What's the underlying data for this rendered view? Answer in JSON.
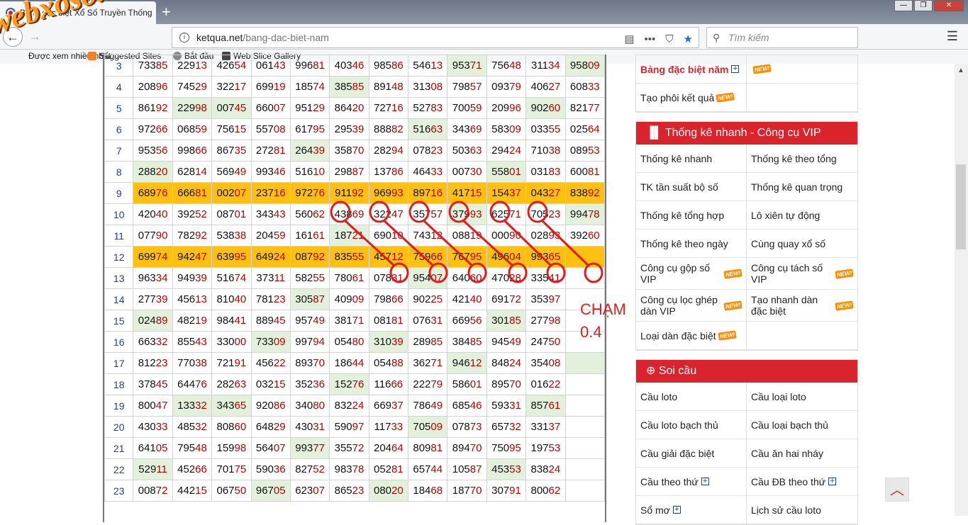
{
  "browser": {
    "tab_title": "Bảng đặc biệt Xổ Số Truyền Thống",
    "url_host": "ketqua.net",
    "url_path": "/bang-dac-biet-nam",
    "search_placeholder": "Tìm kiếm",
    "bookmarks": [
      "Được xem nhiều nhất",
      "Suggested Sites",
      "Bắt đầu",
      "Web Slice Gallery"
    ]
  },
  "watermark": "webxoso.net",
  "table": {
    "rows": [
      {
        "n": "3",
        "v": [
          "73385",
          "22913",
          "42654",
          "06143",
          "99681",
          "40346",
          "98586",
          "54613",
          "95371",
          "75648",
          "31134",
          "95809"
        ],
        "g": [
          8,
          11
        ]
      },
      {
        "n": "4",
        "v": [
          "20896",
          "74529",
          "32217",
          "69919",
          "18574",
          "38585",
          "89148",
          "31308",
          "79857",
          "09379",
          "40627",
          "60833"
        ],
        "g": [
          5
        ]
      },
      {
        "n": "5",
        "v": [
          "86192",
          "22998",
          "00745",
          "66007",
          "95129",
          "86420",
          "72716",
          "52783",
          "70059",
          "20996",
          "90260",
          "82177"
        ],
        "g": [
          1,
          2,
          10
        ]
      },
      {
        "n": "6",
        "v": [
          "97266",
          "06859",
          "75615",
          "55708",
          "61795",
          "29539",
          "88882",
          "51663",
          "34369",
          "58309",
          "03355",
          "02564"
        ],
        "g": [
          7
        ]
      },
      {
        "n": "7",
        "v": [
          "95356",
          "99866",
          "86735",
          "27281",
          "26439",
          "35870",
          "28294",
          "07823",
          "50363",
          "29424",
          "71038",
          "08953"
        ],
        "g": [
          4
        ]
      },
      {
        "n": "8",
        "v": [
          "28820",
          "62814",
          "56949",
          "99346",
          "51610",
          "29887",
          "13786",
          "46433",
          "00730",
          "55801",
          "03183",
          "60081"
        ],
        "g": [
          0,
          9
        ]
      },
      {
        "n": "9",
        "v": [
          "68976",
          "66681",
          "00207",
          "23716",
          "97276",
          "91192",
          "96993",
          "89716",
          "41715",
          "15437",
          "04327",
          "83892"
        ],
        "g": [
          3
        ],
        "hl": true
      },
      {
        "n": "10",
        "v": [
          "42040",
          "39252",
          "08701",
          "34343",
          "56062",
          "43869",
          "32247",
          "35757",
          "37993",
          "62571",
          "70523",
          "99478"
        ],
        "g": [
          8,
          11
        ]
      },
      {
        "n": "11",
        "v": [
          "07790",
          "78292",
          "53838",
          "20459",
          "16161",
          "18721",
          "69010",
          "74312",
          "08819",
          "00090",
          "02893",
          "39260"
        ],
        "g": [
          5
        ]
      },
      {
        "n": "12",
        "v": [
          "69974",
          "94247",
          "63995",
          "64924",
          "08792",
          "83555",
          "45712",
          "75966",
          "76795",
          "49604",
          "99365",
          ""
        ],
        "g": [
          1,
          2
        ],
        "hl": true
      },
      {
        "n": "13",
        "v": [
          "96334",
          "94939",
          "51674",
          "37311",
          "58255",
          "78061",
          "07831",
          "95407",
          "64060",
          "47028",
          "33541",
          ""
        ],
        "g": [
          7
        ]
      },
      {
        "n": "14",
        "v": [
          "27739",
          "45613",
          "81040",
          "78123",
          "30587",
          "40909",
          "79866",
          "90225",
          "42140",
          "69172",
          "35397",
          ""
        ],
        "g": [
          4
        ]
      },
      {
        "n": "15",
        "v": [
          "02489",
          "48219",
          "98441",
          "88945",
          "95749",
          "38171",
          "08181",
          "07631",
          "66956",
          "30185",
          "27798",
          ""
        ],
        "g": [
          0,
          9
        ]
      },
      {
        "n": "16",
        "v": [
          "66332",
          "85543",
          "33000",
          "73309",
          "99794",
          "05480",
          "31039",
          "28985",
          "38485",
          "94549",
          "24750",
          ""
        ],
        "g": [
          3,
          6
        ]
      },
      {
        "n": "17",
        "v": [
          "81223",
          "77038",
          "72191",
          "45622",
          "89370",
          "18644",
          "05488",
          "36271",
          "94612",
          "84824",
          "35408",
          ""
        ],
        "g": [
          8,
          11
        ]
      },
      {
        "n": "18",
        "v": [
          "37845",
          "64476",
          "28263",
          "03215",
          "35236",
          "15276",
          "11666",
          "22279",
          "58601",
          "89570",
          "01622",
          ""
        ],
        "g": [
          5
        ]
      },
      {
        "n": "19",
        "v": [
          "80047",
          "13332",
          "34365",
          "92086",
          "34080",
          "83224",
          "66937",
          "78649",
          "68546",
          "59331",
          "85761",
          ""
        ],
        "g": [
          1,
          2,
          10
        ]
      },
      {
        "n": "20",
        "v": [
          "43033",
          "48532",
          "80860",
          "64829",
          "43031",
          "59097",
          "11733",
          "70509",
          "07873",
          "65732",
          "33137",
          ""
        ],
        "g": [
          7
        ]
      },
      {
        "n": "21",
        "v": [
          "64105",
          "79548",
          "15998",
          "56407",
          "99377",
          "35572",
          "20464",
          "80981",
          "89470",
          "75095",
          "19753",
          ""
        ],
        "g": [
          4
        ]
      },
      {
        "n": "22",
        "v": [
          "52911",
          "45266",
          "70175",
          "59036",
          "82752",
          "98378",
          "05281",
          "65744",
          "10587",
          "45353",
          "83824",
          ""
        ],
        "g": [
          0,
          9
        ]
      },
      {
        "n": "23",
        "v": [
          "00872",
          "44215",
          "06750",
          "96705",
          "62307",
          "86523",
          "08020",
          "18468",
          "18770",
          "30791",
          "80062",
          ""
        ],
        "g": [
          3,
          6
        ]
      }
    ]
  },
  "annotation": {
    "line1": "CHẠM",
    "line2": "0.4"
  },
  "sidebar": {
    "top": {
      "item1": "Bảng đặc biệt năm",
      "item2": "Tạo phôi kết quả"
    },
    "new_label": "NEW!",
    "quick_stats": {
      "title": "Thống kê nhanh - Công cụ VIP",
      "items": [
        "Thống kê nhanh",
        "Thống kê theo tổng",
        "TK tần suất bộ số",
        "Thống kê quan trọng",
        "Thống kê tổng hợp",
        "Lô xiên tự động",
        "Thống kê theo ngày",
        "Cùng quay xổ số",
        "Công cụ gộp số VIP",
        "Công cụ tách số VIP",
        "Công cụ lọc ghép dàn VIP",
        "Tạo nhanh dàn đặc biệt",
        "Loại dàn đặc biệt",
        ""
      ]
    },
    "soi_cau": {
      "title": "Soi cầu",
      "items": [
        "Cầu loto",
        "Cầu loại loto",
        "Cầu loto bạch thủ",
        "Cầu loại bạch thủ",
        "Cầu giải đặc biệt",
        "Cầu ăn hai nháy",
        "Cầu theo thứ",
        "Cầu ĐB theo thứ",
        "Sổ mơ",
        "Lịch sử cầu loto"
      ]
    }
  }
}
